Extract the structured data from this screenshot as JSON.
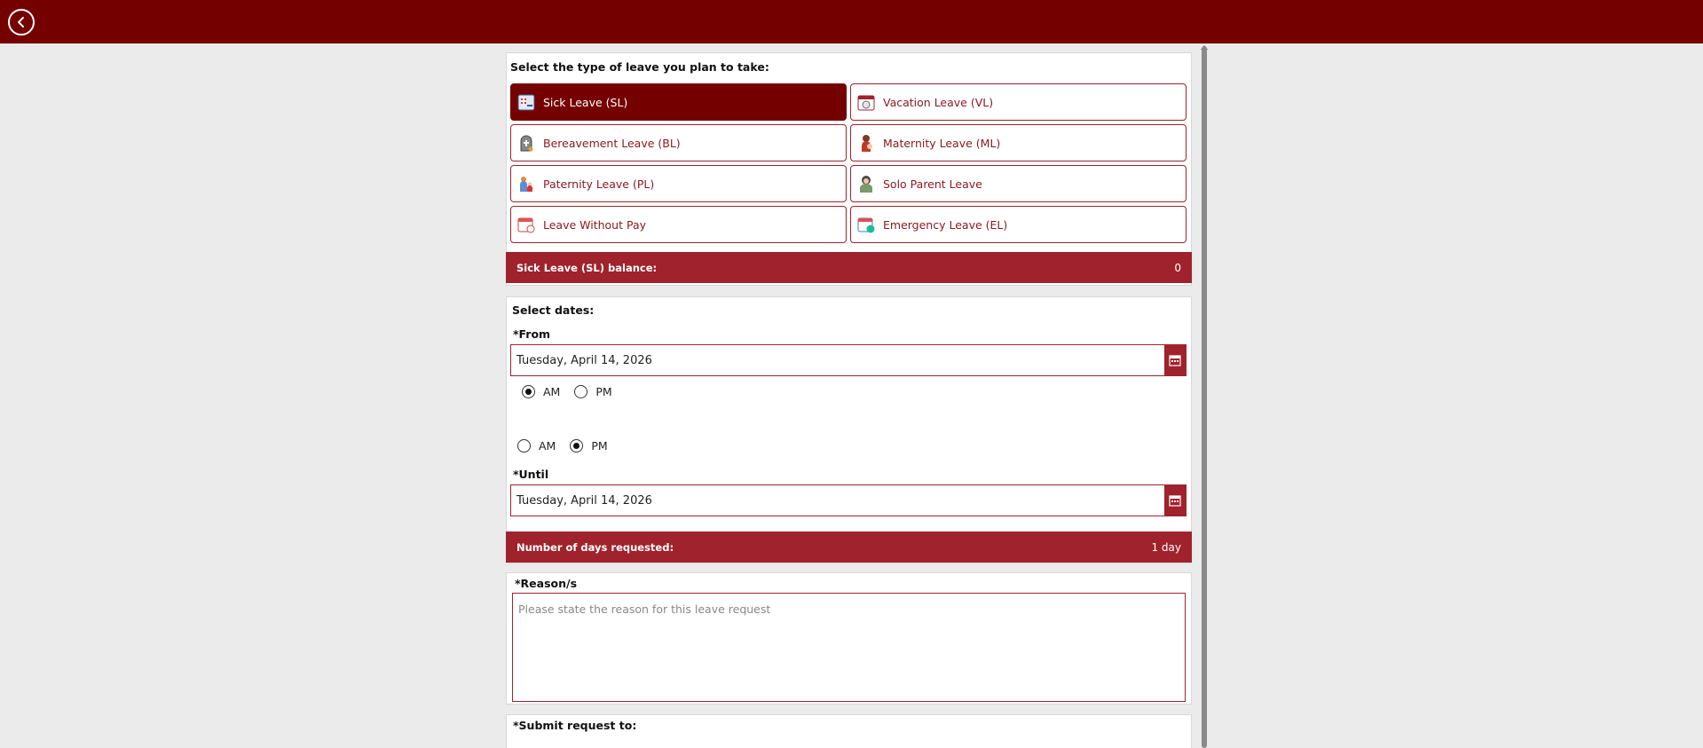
{
  "header": {
    "back_icon": "chevron-left-icon",
    "color": "#750000"
  },
  "leave_type": {
    "prompt": "Select the type of leave you plan to take:",
    "options": [
      {
        "label": "Sick Leave (SL)",
        "icon": "sick-leave-icon",
        "selected": true
      },
      {
        "label": "Vacation Leave (VL)",
        "icon": "vacation-leave-icon",
        "selected": false
      },
      {
        "label": "Bereavement Leave (BL)",
        "icon": "bereavement-leave-icon",
        "selected": false
      },
      {
        "label": "Maternity Leave (ML)",
        "icon": "maternity-leave-icon",
        "selected": false
      },
      {
        "label": "Paternity Leave (PL)",
        "icon": "paternity-leave-icon",
        "selected": false
      },
      {
        "label": "Solo Parent Leave",
        "icon": "solo-parent-leave-icon",
        "selected": false
      },
      {
        "label": "Leave Without Pay",
        "icon": "leave-without-pay-icon",
        "selected": false
      },
      {
        "label": "Emergency Leave (EL)",
        "icon": "emergency-leave-icon",
        "selected": false
      }
    ],
    "balance_label": "Sick Leave (SL) balance:",
    "balance_value": "0"
  },
  "dates": {
    "title": "Select dates:",
    "from_label": "*From",
    "from_value": "Tuesday, April 14, 2026",
    "from_ampm": {
      "am": "AM",
      "pm": "PM",
      "selected": "AM"
    },
    "until_ampm": {
      "am": "AM",
      "pm": "PM",
      "selected": "PM"
    },
    "until_label": "*Until",
    "until_value": "Tuesday, April 14, 2026",
    "days_label": "Number of days requested:",
    "days_value": "1 day"
  },
  "reason": {
    "label": "*Reason/s",
    "placeholder": "Please state the reason for this leave request"
  },
  "submit": {
    "label": "*Submit request to:"
  },
  "colors": {
    "accent": "#a0222c",
    "dark": "#750000"
  }
}
